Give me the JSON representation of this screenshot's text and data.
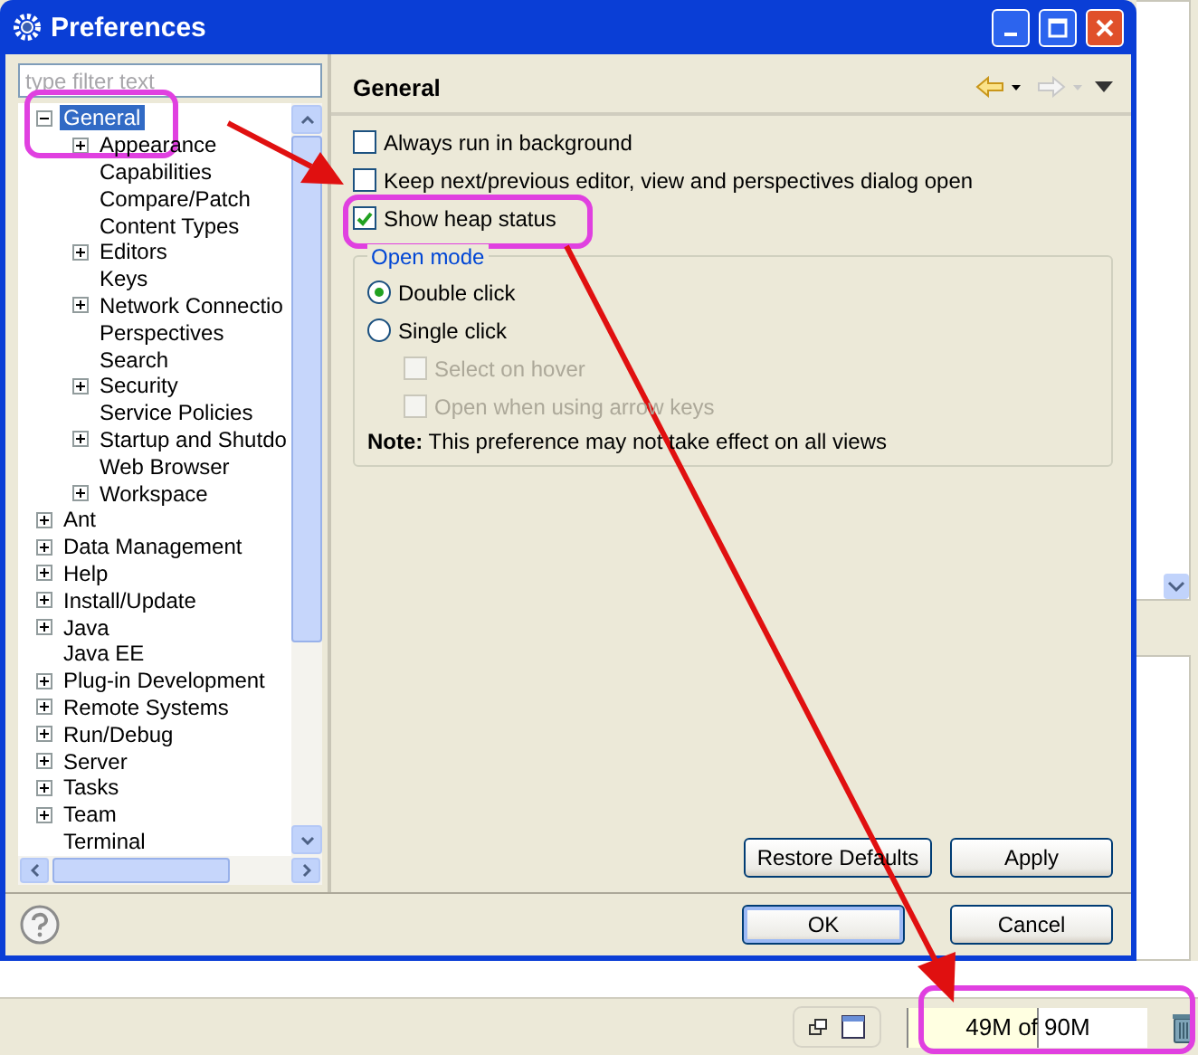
{
  "window": {
    "title": "Preferences"
  },
  "filter": {
    "placeholder": "type filter text"
  },
  "tree": [
    {
      "label": "General",
      "kind": "branch",
      "expanded": true,
      "selected": true,
      "children": [
        {
          "label": "Appearance",
          "kind": "branch",
          "expanded": false,
          "selected": false
        },
        {
          "label": "Capabilities",
          "kind": "leaf",
          "selected": false
        },
        {
          "label": "Compare/Patch",
          "kind": "leaf",
          "selected": false
        },
        {
          "label": "Content Types",
          "kind": "leaf",
          "selected": false
        },
        {
          "label": "Editors",
          "kind": "branch",
          "expanded": false,
          "selected": false
        },
        {
          "label": "Keys",
          "kind": "leaf",
          "selected": false
        },
        {
          "label": "Network Connectio",
          "kind": "branch",
          "expanded": false,
          "selected": false
        },
        {
          "label": "Perspectives",
          "kind": "leaf",
          "selected": false
        },
        {
          "label": "Search",
          "kind": "leaf",
          "selected": false
        },
        {
          "label": "Security",
          "kind": "branch",
          "expanded": false,
          "selected": false
        },
        {
          "label": "Service Policies",
          "kind": "leaf",
          "selected": false
        },
        {
          "label": "Startup and Shutdo",
          "kind": "branch",
          "expanded": false,
          "selected": false
        },
        {
          "label": "Web Browser",
          "kind": "leaf",
          "selected": false
        },
        {
          "label": "Workspace",
          "kind": "branch",
          "expanded": false,
          "selected": false
        }
      ]
    },
    {
      "label": "Ant",
      "kind": "branch",
      "expanded": false,
      "selected": false
    },
    {
      "label": "Data Management",
      "kind": "branch",
      "expanded": false,
      "selected": false
    },
    {
      "label": "Help",
      "kind": "branch",
      "expanded": false,
      "selected": false
    },
    {
      "label": "Install/Update",
      "kind": "branch",
      "expanded": false,
      "selected": false
    },
    {
      "label": "Java",
      "kind": "branch",
      "expanded": false,
      "selected": false
    },
    {
      "label": "Java EE",
      "kind": "leaf",
      "selected": false
    },
    {
      "label": "Plug-in Development",
      "kind": "branch",
      "expanded": false,
      "selected": false
    },
    {
      "label": "Remote Systems",
      "kind": "branch",
      "expanded": false,
      "selected": false
    },
    {
      "label": "Run/Debug",
      "kind": "branch",
      "expanded": false,
      "selected": false
    },
    {
      "label": "Server",
      "kind": "branch",
      "expanded": false,
      "selected": false
    },
    {
      "label": "Tasks",
      "kind": "branch",
      "expanded": false,
      "selected": false
    },
    {
      "label": "Team",
      "kind": "branch",
      "expanded": false,
      "selected": false
    },
    {
      "label": "Terminal",
      "kind": "leaf",
      "selected": false
    }
  ],
  "page": {
    "title": "General",
    "options": [
      {
        "label": "Always run in background",
        "checked": false
      },
      {
        "label": "Keep next/previous editor, view and perspectives dialog open",
        "checked": false
      },
      {
        "label": "Show heap status",
        "checked": true
      }
    ],
    "open_mode": {
      "title": "Open mode",
      "choices": [
        {
          "label": "Double click",
          "selected": true
        },
        {
          "label": "Single click",
          "selected": false
        }
      ],
      "sub_options": [
        {
          "label": "Select on hover",
          "checked": false,
          "disabled": true
        },
        {
          "label": "Open when using arrow keys",
          "checked": false,
          "disabled": true
        }
      ],
      "note_label": "Note:",
      "note": "This preference may not take effect on all views"
    },
    "buttons": [
      "Restore Defaults",
      "Apply"
    ]
  },
  "dialog_buttons": [
    "OK",
    "Cancel"
  ],
  "status_bar": {
    "heap": {
      "reading": "49M of 90M",
      "level": 0.54
    }
  }
}
